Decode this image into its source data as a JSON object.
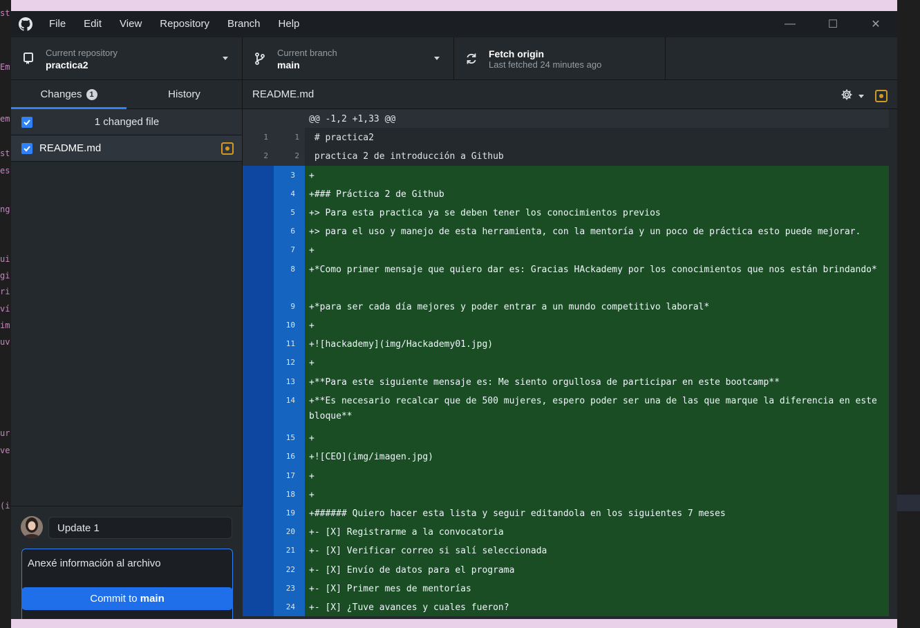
{
  "bg_editor": {
    "fragments": [
      "st",
      "Em",
      "em",
      "st",
      "es",
      "ng",
      "ui",
      "gi",
      "ri",
      "ví",
      "im",
      "uv",
      "ur",
      "ve",
      "(i"
    ]
  },
  "menu": [
    "File",
    "Edit",
    "View",
    "Repository",
    "Branch",
    "Help"
  ],
  "window_controls": {
    "minimize": "—",
    "maximize": "☐",
    "close": "✕"
  },
  "toolbar": {
    "repo": {
      "sub": "Current repository",
      "main": "practica2"
    },
    "branch": {
      "sub": "Current branch",
      "main": "main"
    },
    "fetch": {
      "main": "Fetch origin",
      "sub": "Last fetched 24 minutes ago"
    }
  },
  "sidebar": {
    "tabs": {
      "changes": "Changes",
      "changes_count": "1",
      "history": "History"
    },
    "changed_files_label": "1 changed file",
    "files": [
      {
        "name": "README.md"
      }
    ]
  },
  "commit": {
    "summary": "Update 1",
    "description": "Anexé información al archivo",
    "button_prefix": "Commit to ",
    "button_branch": "main"
  },
  "diff": {
    "file": "README.md",
    "hunk": "@@ -1,2 +1,33 @@",
    "lines": [
      {
        "type": "ctx",
        "old": "1",
        "new": "1",
        "text": " # practica2"
      },
      {
        "type": "ctx",
        "old": "2",
        "new": "2",
        "text": " practica 2 de introducción a Github"
      },
      {
        "type": "add",
        "old": "",
        "new": "3",
        "text": "+"
      },
      {
        "type": "add",
        "old": "",
        "new": "4",
        "text": "+### Práctica 2 de Github"
      },
      {
        "type": "add",
        "old": "",
        "new": "5",
        "text": "+> Para esta practica ya se deben tener los conocimientos previos"
      },
      {
        "type": "add",
        "old": "",
        "new": "6",
        "text": "+> para el uso y manejo de esta herramienta, con la mentoría y un poco de práctica esto puede mejorar."
      },
      {
        "type": "add",
        "old": "",
        "new": "7",
        "text": "+"
      },
      {
        "type": "add",
        "old": "",
        "new": "8",
        "text": "+*Como primer mensaje que quiero dar es: Gracias HAckademy por los conocimientos que nos están brindando*",
        "tall": true
      },
      {
        "type": "add",
        "old": "",
        "new": "9",
        "text": "+*para ser cada día mejores y poder entrar a un mundo competitivo laboral*"
      },
      {
        "type": "add",
        "old": "",
        "new": "10",
        "text": "+"
      },
      {
        "type": "add",
        "old": "",
        "new": "11",
        "text": "+![hackademy](img/Hackademy01.jpg)"
      },
      {
        "type": "add",
        "old": "",
        "new": "12",
        "text": "+"
      },
      {
        "type": "add",
        "old": "",
        "new": "13",
        "text": "+**Para este siguiente mensaje es: Me siento orgullosa de participar en este bootcamp**"
      },
      {
        "type": "add",
        "old": "",
        "new": "14",
        "text": "+**Es necesario recalcar que de 500 mujeres, espero poder ser una de las que marque la diferencia en este bloque**",
        "tall": true
      },
      {
        "type": "add",
        "old": "",
        "new": "15",
        "text": "+"
      },
      {
        "type": "add",
        "old": "",
        "new": "16",
        "text": "+![CEO](img/imagen.jpg)"
      },
      {
        "type": "add",
        "old": "",
        "new": "17",
        "text": "+"
      },
      {
        "type": "add",
        "old": "",
        "new": "18",
        "text": "+"
      },
      {
        "type": "add",
        "old": "",
        "new": "19",
        "text": "+###### Quiero hacer esta lista y seguir editandola en los siguientes 7 meses"
      },
      {
        "type": "add",
        "old": "",
        "new": "20",
        "text": "+- [X] Registrarme a la convocatoria"
      },
      {
        "type": "add",
        "old": "",
        "new": "21",
        "text": "+- [X] Verificar correo si salí seleccionada"
      },
      {
        "type": "add",
        "old": "",
        "new": "22",
        "text": "+- [X] Envío de datos para el programa"
      },
      {
        "type": "add",
        "old": "",
        "new": "23",
        "text": "+- [X] Primer mes de mentorías"
      },
      {
        "type": "add",
        "old": "",
        "new": "24",
        "text": "+- [X] ¿Tuve avances y cuales fueron?"
      }
    ]
  }
}
